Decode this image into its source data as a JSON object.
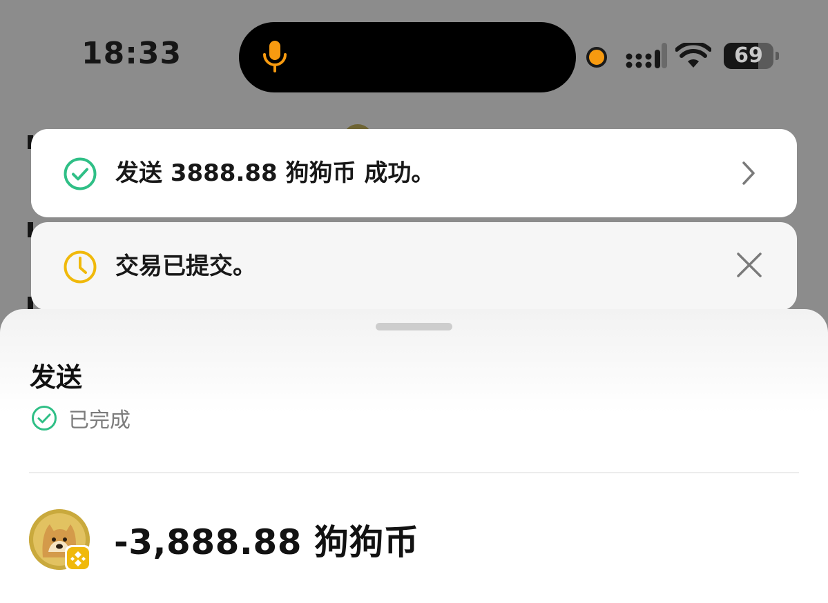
{
  "status_bar": {
    "time": "18:33",
    "battery": "69",
    "battery_level": 0.69
  },
  "toasts": {
    "success": {
      "text": "发送 3888.88 狗狗币 成功。"
    },
    "pending": {
      "text": "交易已提交。"
    }
  },
  "sheet": {
    "title": "发送",
    "status": "已完成",
    "amount": "-3,888.88 狗狗币"
  },
  "colors": {
    "success_green": "#2fbf86",
    "pending_yellow": "#f0b90b",
    "mic_orange": "#f79a10"
  }
}
